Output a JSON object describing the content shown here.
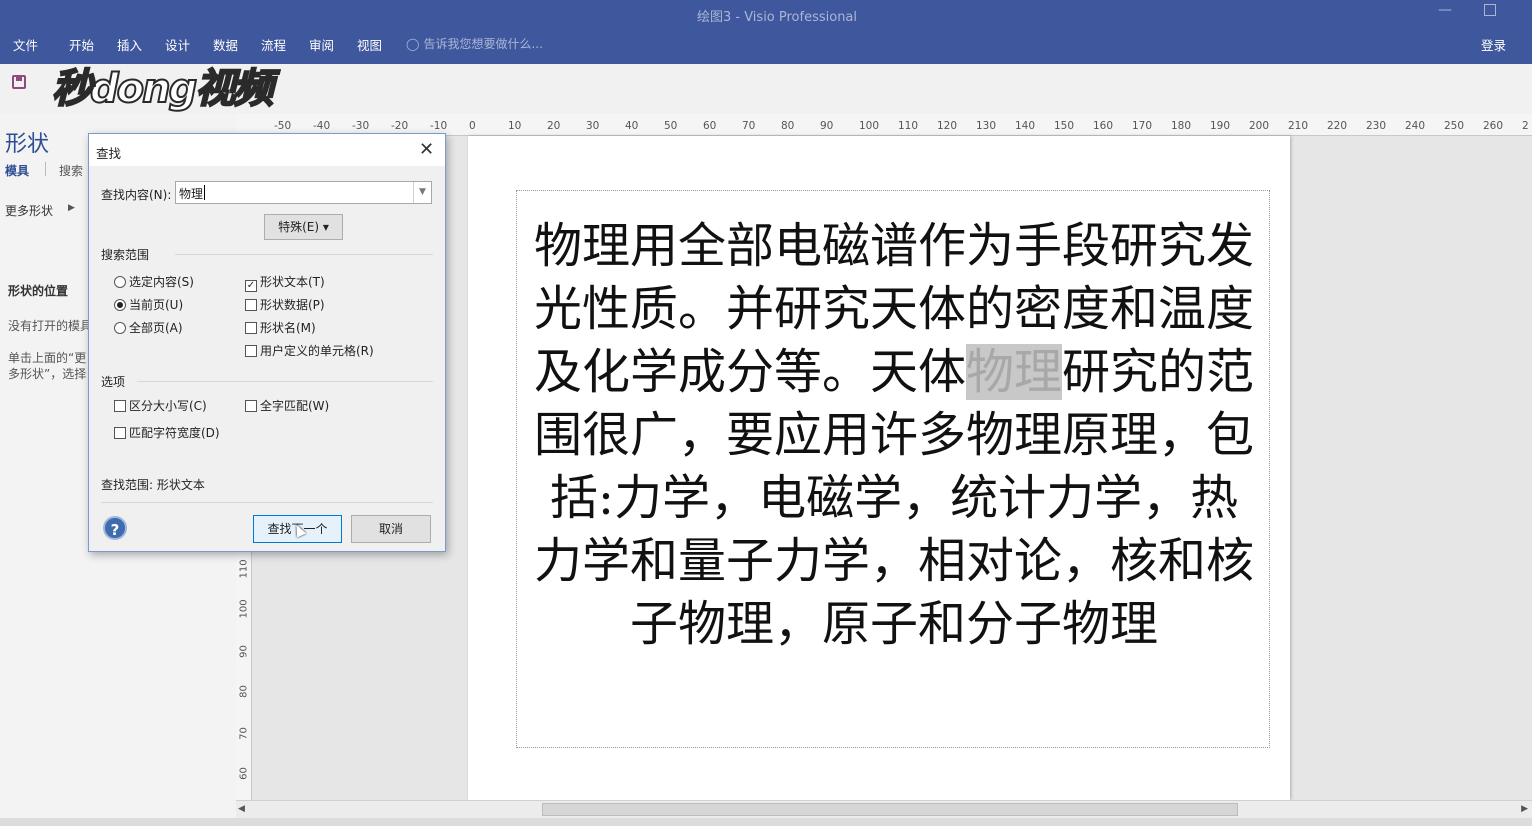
{
  "window": {
    "title": "绘图3 - Visio Professional"
  },
  "ribbon": {
    "tabs": [
      "文件",
      "开始",
      "插入",
      "设计",
      "数据",
      "流程",
      "审阅",
      "视图"
    ],
    "tell_me": "告诉我您想要做什么...",
    "login": "登录"
  },
  "watermark": "秒dong视频",
  "shapes_pane": {
    "title": "形状",
    "tab_stencils": "模具",
    "tab_search": "搜索",
    "more_shapes": "更多形状",
    "location_header": "形状的位置",
    "no_open_text": "没有打开的模具",
    "hint_text": "单击上面的“更多形状”，选择一个类别并打开模具"
  },
  "ruler": {
    "top_labels": [
      "-50",
      "-40",
      "-30",
      "-20",
      "-10",
      "0",
      "10",
      "20",
      "30",
      "40",
      "50",
      "60",
      "70",
      "80",
      "90",
      "100",
      "110",
      "120",
      "130",
      "140",
      "150",
      "160",
      "170",
      "180",
      "190",
      "200",
      "210",
      "220",
      "230",
      "240",
      "250",
      "260",
      "2"
    ],
    "left_labels": [
      "110",
      "100",
      "90",
      "80",
      "70",
      "60"
    ]
  },
  "canvas": {
    "text_before": "物理用全部电磁谱作为手段研究发光性质。并研究天体的密度和温度及化学成分等。天体",
    "text_highlight": "物理",
    "text_after": "研究的范围很广，要应用许多物理原理，包括:力学，电磁学，统计力学，热力学和量子力学，相对论，核和核子物理，原子和分子物理"
  },
  "find_dialog": {
    "title": "查找",
    "find_label": "查找内容(N):",
    "find_value": "物理",
    "special_button": "特殊(E) ▾",
    "search_scope_label": "搜索范围",
    "scope_options": [
      {
        "label": "选定内容(S)",
        "selected": false
      },
      {
        "label": "当前页(U)",
        "selected": true
      },
      {
        "label": "全部页(A)",
        "selected": false
      }
    ],
    "search_in_options": [
      {
        "label": "形状文本(T)",
        "checked": true
      },
      {
        "label": "形状数据(P)",
        "checked": false
      },
      {
        "label": "形状名(M)",
        "checked": false
      },
      {
        "label": "用户定义的单元格(R)",
        "checked": false
      }
    ],
    "options_label": "选项",
    "option_checks": [
      {
        "label": "区分大小写(C)",
        "checked": false
      },
      {
        "label": "全字匹配(W)",
        "checked": false
      },
      {
        "label": "匹配字符宽度(D)",
        "checked": false
      }
    ],
    "scope_summary": "查找范围:  形状文本",
    "help_glyph": "?",
    "find_next_button": "查找下一个",
    "cancel_button": "取消"
  }
}
